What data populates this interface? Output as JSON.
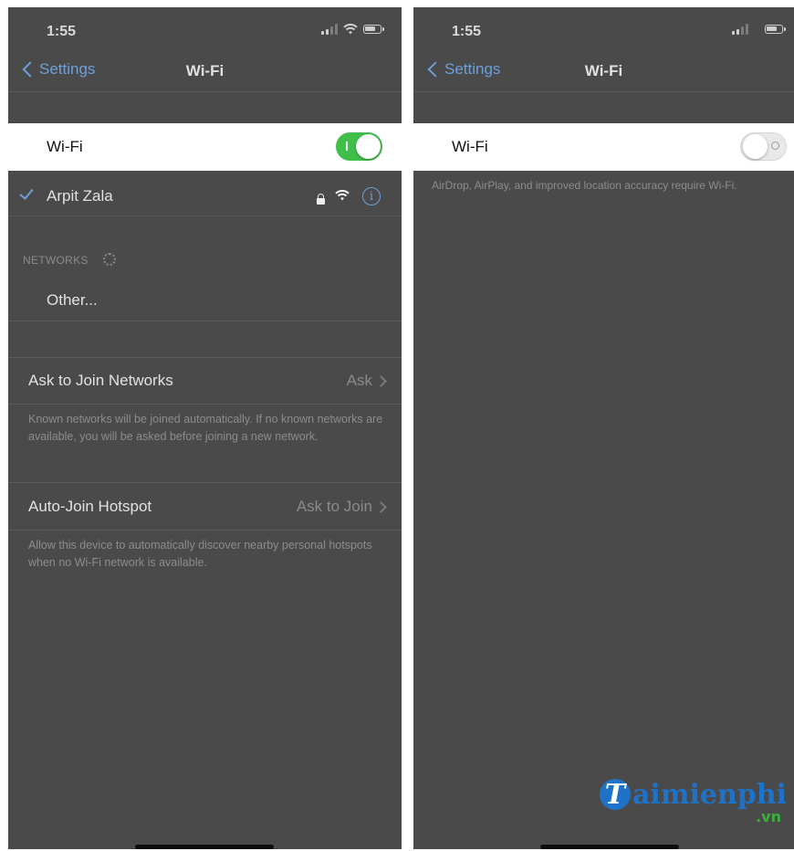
{
  "left_screen": {
    "status_time": "1:55",
    "back_label": "Settings",
    "nav_title": "Wi-Fi",
    "wifi_label": "Wi-Fi",
    "wifi_on": true,
    "connected_network": "Arpit Zala",
    "networks_header": "NETWORKS",
    "other_label": "Other...",
    "ask_to_join_label": "Ask to Join Networks",
    "ask_to_join_value": "Ask",
    "ask_to_join_footnote": "Known networks will be joined automatically. If no known networks are available, you will be asked before joining a new network.",
    "auto_join_label": "Auto-Join Hotspot",
    "auto_join_value": "Ask to Join",
    "auto_join_footnote": "Allow this device to automatically discover nearby personal hotspots when no Wi-Fi network is available."
  },
  "right_screen": {
    "status_time": "1:55",
    "back_label": "Settings",
    "nav_title": "Wi-Fi",
    "wifi_label": "Wi-Fi",
    "wifi_on": false,
    "footnote": "AirDrop, AirPlay, and improved location accuracy require Wi-Fi."
  },
  "watermark": {
    "initial": "T",
    "text": "aimienphi",
    "suffix": ".vn"
  },
  "colors": {
    "background": "#4a4a4a",
    "accent_blue": "#6f9fd8",
    "toggle_green": "#3fbf4a",
    "watermark_blue": "#1e73c8",
    "watermark_green": "#3bb03b"
  },
  "icons": [
    "chevron-left-icon",
    "signal-icon",
    "wifi-icon",
    "battery-icon",
    "checkmark-icon",
    "lock-icon",
    "info-icon",
    "spinner-icon",
    "chevron-right-icon"
  ]
}
